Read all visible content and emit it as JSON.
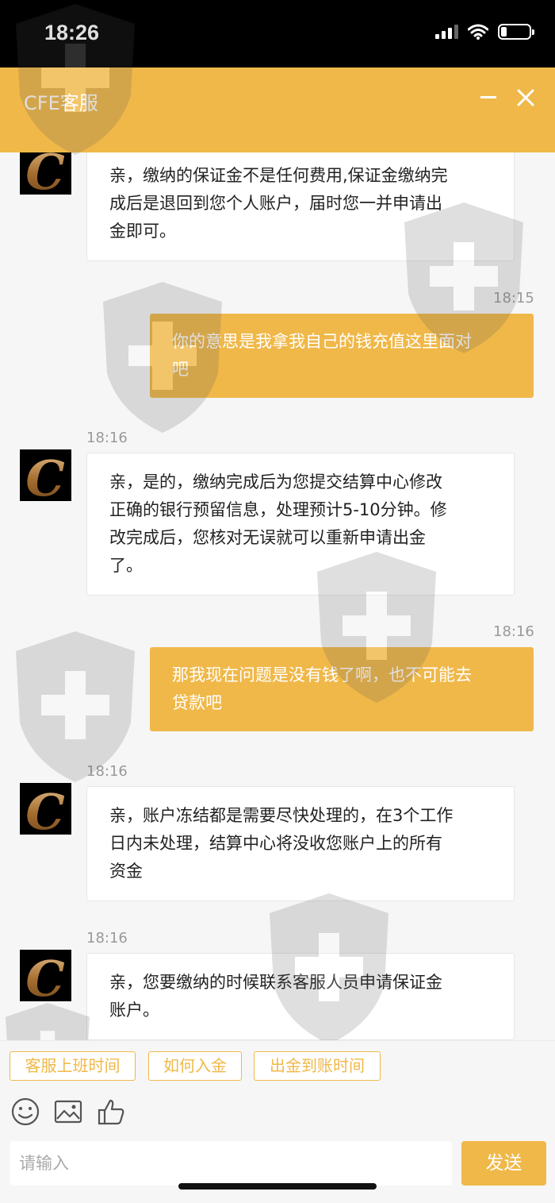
{
  "status_bar": {
    "time": "18:26",
    "signal_icon": "signal-icon",
    "wifi_icon": "wifi-icon",
    "battery_icon": "battery-icon",
    "battery_level": 0.22
  },
  "header": {
    "title": "CFE客服",
    "minimize_icon": "minimize-icon",
    "close_icon": "close-icon"
  },
  "colors": {
    "accent": "#f0b849",
    "bubble_in": "#ffffff",
    "timestamp": "#999999",
    "background": "#f6f6f6"
  },
  "messages": [
    {
      "from": "agent",
      "time": "",
      "lines": [
        "亲，缴纳的保证金不是任何费用,保证金缴纳完",
        "成后是退回到您个人账户，届时您一并申请出",
        "金即可。"
      ]
    },
    {
      "from": "user",
      "time": "18:15",
      "lines": [
        "你的意思是我拿我自己的钱充值这里面对",
        "吧"
      ]
    },
    {
      "from": "agent",
      "time": "18:16",
      "lines": [
        "亲，是的，缴纳完成后为您提交结算中心修改",
        "正确的银行预留信息，处理预计5-10分钟。修",
        "改完成后，您核对无误就可以重新申请出金",
        "了。"
      ]
    },
    {
      "from": "user",
      "time": "18:16",
      "lines": [
        "那我现在问题是没有钱了啊，也不可能去",
        "贷款吧"
      ]
    },
    {
      "from": "agent",
      "time": "18:16",
      "lines": [
        "亲，账户冻结都是需要尽快处理的，在3个工作",
        "日内未处理，结算中心将没收您账户上的所有",
        "资金"
      ]
    },
    {
      "from": "agent",
      "time": "18:16",
      "lines": [
        "亲，您要缴纳的时候联系客服人员申请保证金",
        "账户。"
      ]
    }
  ],
  "quick_replies": [
    "客服上班时间",
    "如何入金",
    "出金到账时间"
  ],
  "toolbar": {
    "emoji_icon": "emoji-icon",
    "image_icon": "image-icon",
    "thumbs_up_icon": "thumbs-up-icon"
  },
  "input": {
    "placeholder": "请输入",
    "value": ""
  },
  "send_label": "发送"
}
